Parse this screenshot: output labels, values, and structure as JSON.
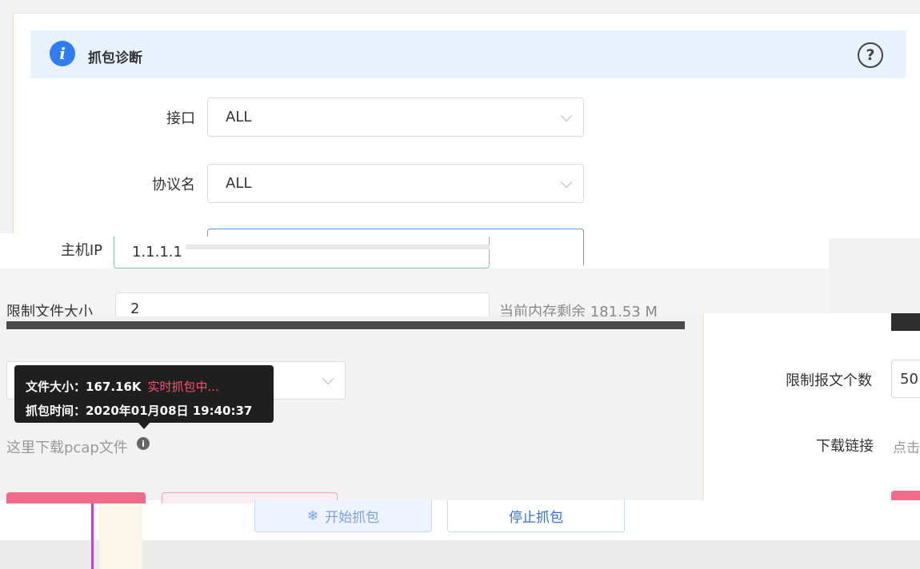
{
  "header": {
    "title": "抓包诊断",
    "info_icon": "i",
    "help_icon": "?"
  },
  "form": {
    "interface": {
      "label": "接口",
      "value": "ALL"
    },
    "protocol": {
      "label": "协议名",
      "value": "ALL"
    },
    "host_ip": {
      "label": "主机IP",
      "value": "1.1.1.1"
    },
    "file_size_limit": {
      "label": "限制文件大小",
      "value": "2",
      "remaining": "当前内存剩余 181.53 M"
    }
  },
  "tooltip": {
    "size_label": "文件大小：",
    "size_value": "167.16K",
    "status": "实时抓包中...",
    "time_label": "抓包时间：",
    "time_value": "2020年01月08日 19:40:37"
  },
  "download": {
    "text": "这里下载pcap文件",
    "right_label": "下载链接",
    "right_value": "点击"
  },
  "packet_limit": {
    "label": "限制报文个数",
    "value": "50"
  },
  "buttons": {
    "start": "开始抓包",
    "stop": "停止抓包"
  },
  "colors": {
    "accent": "#2f7df6",
    "danger": "#f06a8a",
    "header_bg": "#e8f2fd"
  }
}
